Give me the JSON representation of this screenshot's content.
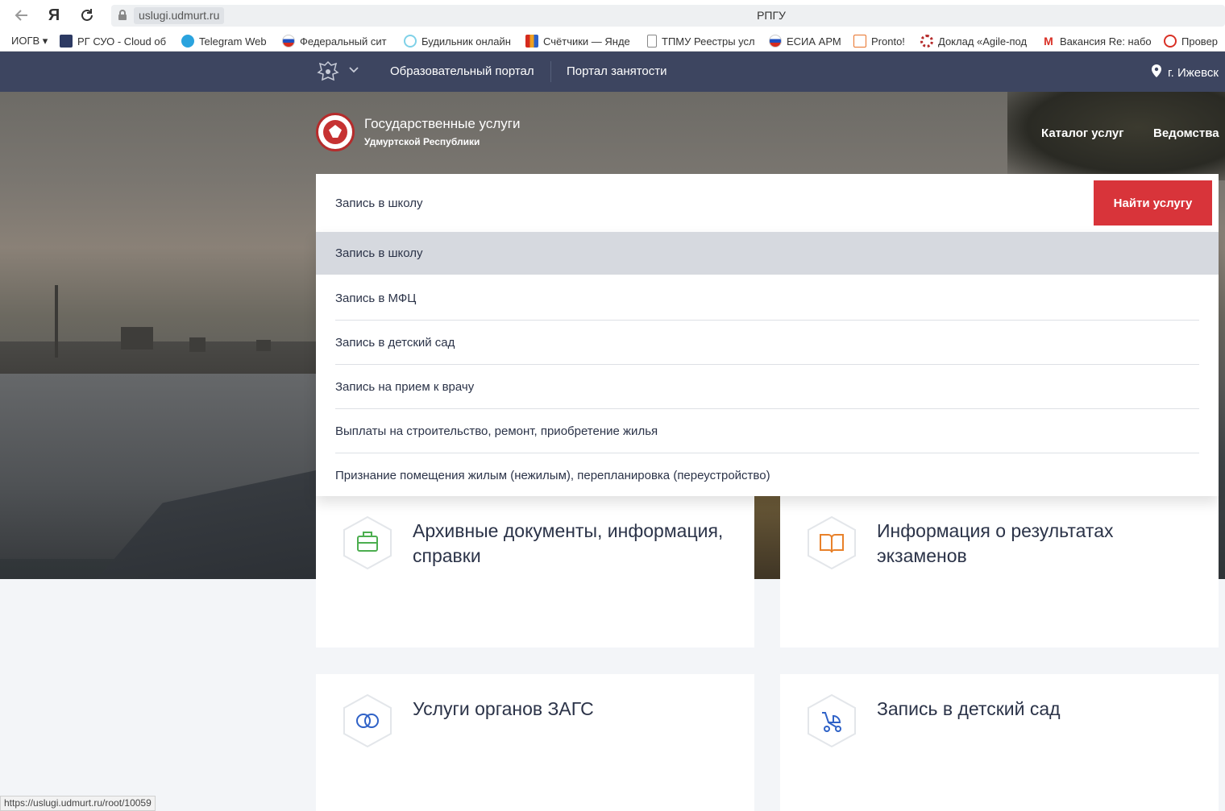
{
  "browser": {
    "url": "uslugi.udmurt.ru",
    "page_title": "РПГУ",
    "bookmarks": [
      {
        "label": "ИОГВ ▾",
        "icon": "folder-icon",
        "color": "#ffffff"
      },
      {
        "label": "РГ СУО - Cloud об",
        "icon": "cloud-icon",
        "color": "#2d3a63"
      },
      {
        "label": "Telegram Web",
        "icon": "telegram-icon",
        "color": "#2aa3de"
      },
      {
        "label": "Федеральный сит",
        "icon": "russia-flag-icon",
        "color": "#1f4fbf"
      },
      {
        "label": "Будильник онлайн",
        "icon": "clock-icon",
        "color": "#7fd1e8"
      },
      {
        "label": "Счётчики — Янде",
        "icon": "metrica-icon",
        "color": "#f0a020"
      },
      {
        "label": "ТПМУ Реестры усл",
        "icon": "document-icon",
        "color": "#888888"
      },
      {
        "label": "ЕСИА АРМ",
        "icon": "russia-flag-icon",
        "color": "#1f4fbf"
      },
      {
        "label": "Pronto!",
        "icon": "pronto-icon",
        "color": "#e8732a"
      },
      {
        "label": "Доклад «Agile-под",
        "icon": "gear-icon",
        "color": "#b52b2b"
      },
      {
        "label": "Вакансия Re: набо",
        "icon": "gmail-icon",
        "color": "#d93025"
      },
      {
        "label": "Провер",
        "icon": "copyright-icon",
        "color": "#d93025"
      }
    ],
    "status_url": "https://uslugi.udmurt.ru/root/10059"
  },
  "portal_bar": {
    "links": [
      "Образовательный портал",
      "Портал занятости"
    ],
    "city": "г. Ижевск"
  },
  "brand": {
    "title": "Государственные услуги",
    "subtitle": "Удмуртской Республики"
  },
  "hero_nav": [
    "Каталог услуг",
    "Ведомства"
  ],
  "search": {
    "value": "Запись в школу",
    "button": "Найти услугу"
  },
  "suggestions": [
    "Запись в школу",
    "Запись в МФЦ",
    "Запись в детский сад",
    "Запись на прием к врачу",
    "Выплаты на строительство, ремонт, приобретение жилья",
    "Признание помещения жилым (нежилым), перепланировка (переустройство)"
  ],
  "cards": [
    {
      "title": "Архивные документы, информация, справки",
      "icon": "briefcase-icon",
      "color": "#4cae4f"
    },
    {
      "title": "Информация о результатах экзаменов",
      "icon": "book-icon",
      "color": "#e8812a"
    },
    {
      "title": "Услуги органов ЗАГС",
      "icon": "rings-icon",
      "color": "#2f62c7"
    },
    {
      "title": "Запись в детский сад",
      "icon": "stroller-icon",
      "color": "#2f62c7"
    }
  ],
  "colors": {
    "portal_bar": "#3d4560",
    "accent_button": "#d8343a",
    "active_suggestion": "#d6d9df"
  }
}
